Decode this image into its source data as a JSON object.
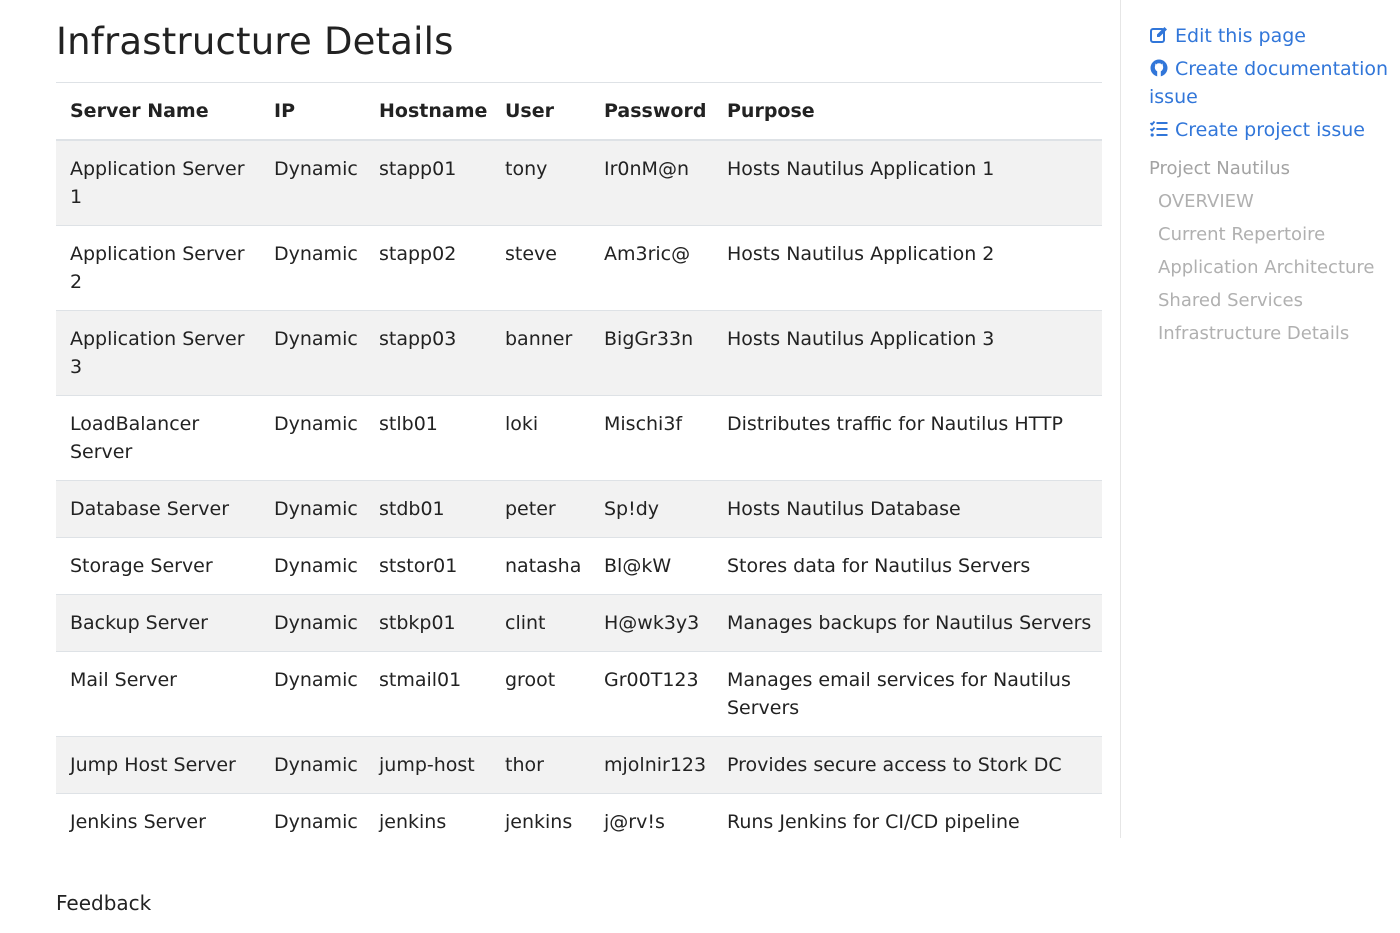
{
  "page": {
    "title": "Infrastructure Details",
    "feedback": "Feedback"
  },
  "table": {
    "headers": [
      "Server Name",
      "IP",
      "Hostname",
      "User",
      "Password",
      "Purpose"
    ],
    "rows": [
      [
        "Application Server 1",
        "Dynamic",
        "stapp01",
        "tony",
        "Ir0nM@n",
        "Hosts Nautilus Application 1"
      ],
      [
        "Application Server 2",
        "Dynamic",
        "stapp02",
        "steve",
        "Am3ric@",
        "Hosts Nautilus Application 2"
      ],
      [
        "Application Server 3",
        "Dynamic",
        "stapp03",
        "banner",
        "BigGr33n",
        "Hosts Nautilus Application 3"
      ],
      [
        "LoadBalancer Server",
        "Dynamic",
        "stlb01",
        "loki",
        "Mischi3f",
        "Distributes traffic for Nautilus HTTP"
      ],
      [
        "Database Server",
        "Dynamic",
        "stdb01",
        "peter",
        "Sp!dy",
        "Hosts Nautilus Database"
      ],
      [
        "Storage Server",
        "Dynamic",
        "ststor01",
        "natasha",
        "Bl@kW",
        "Stores data for Nautilus Servers"
      ],
      [
        "Backup Server",
        "Dynamic",
        "stbkp01",
        "clint",
        "H@wk3y3",
        "Manages backups for Nautilus Servers"
      ],
      [
        "Mail Server",
        "Dynamic",
        "stmail01",
        "groot",
        "Gr00T123",
        "Manages email services for Nautilus Servers"
      ],
      [
        "Jump Host Server",
        "Dynamic",
        "jump-host",
        "thor",
        "mjolnir123",
        "Provides secure access to Stork DC"
      ],
      [
        "Jenkins Server",
        "Dynamic",
        "jenkins",
        "jenkins",
        "j@rv!s",
        "Runs Jenkins for CI/CD pipeline"
      ]
    ]
  },
  "sidebar": {
    "links": [
      {
        "label": "Edit this page",
        "icon": "edit-icon"
      },
      {
        "label": "Create documentation issue",
        "icon": "github-icon"
      },
      {
        "label": "Create project issue",
        "icon": "tasks-icon"
      }
    ],
    "nav": {
      "root": "Project Nautilus",
      "items": [
        "OVERVIEW",
        "Current Repertoire",
        "Application Architecture",
        "Shared Services",
        "Infrastructure Details"
      ]
    }
  },
  "colors": {
    "link": "#3176d9",
    "nav_text": "#b0b0b0",
    "row_stripe": "#f2f2f2",
    "border": "#dee2e6"
  }
}
